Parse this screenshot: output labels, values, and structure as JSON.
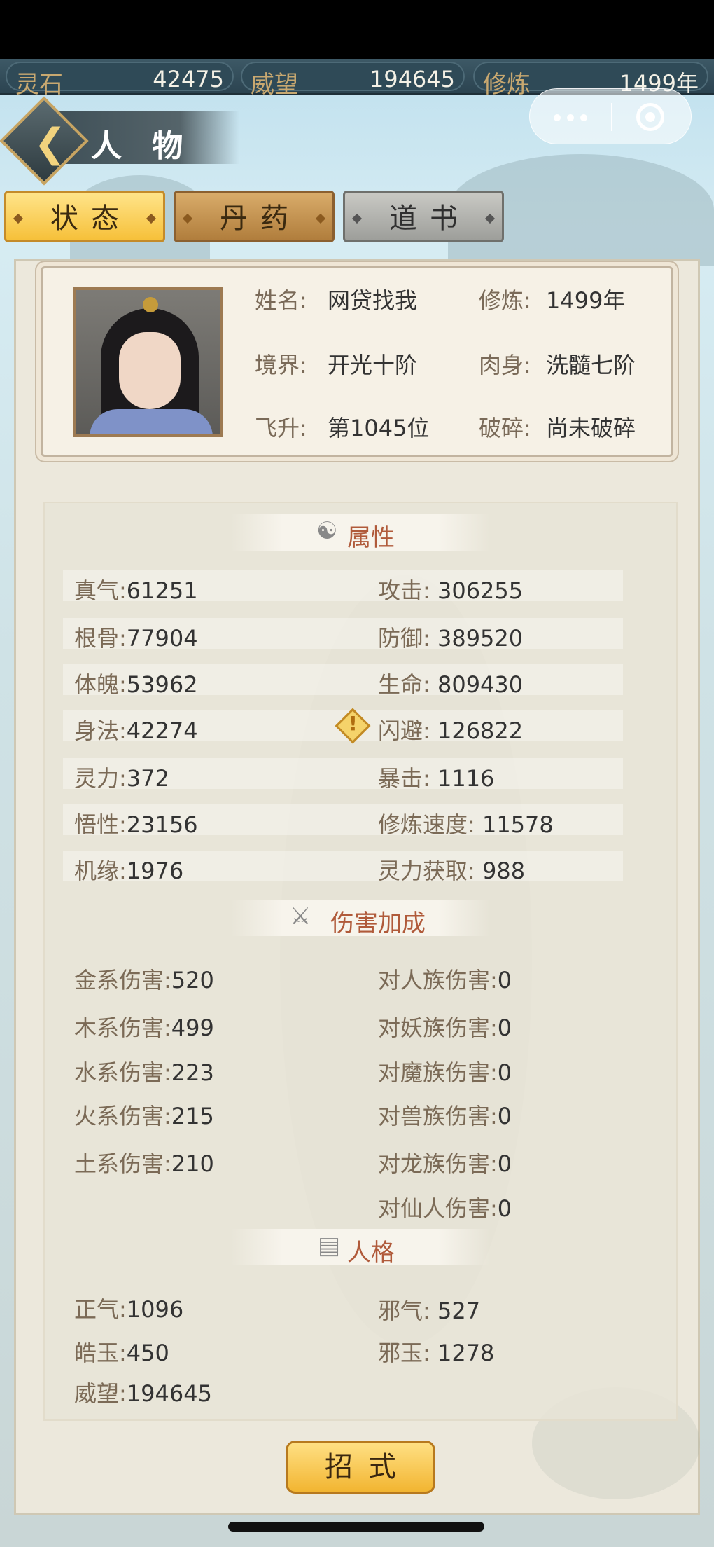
{
  "resources": [
    {
      "label": "灵石",
      "value": "42475"
    },
    {
      "label": "威望",
      "value": "194645"
    },
    {
      "label": "修炼",
      "value": "1499年"
    }
  ],
  "header": {
    "title": "人 物"
  },
  "tabs": [
    {
      "label": "状态",
      "active": true
    },
    {
      "label": "丹药",
      "active": false
    },
    {
      "label": "道书",
      "active": false
    }
  ],
  "profile": {
    "name_label": "姓名:",
    "name_value": "网贷找我",
    "cultivation_label": "修炼:",
    "cultivation_value": "1499年",
    "realm_label": "境界:",
    "realm_value": "开光十阶",
    "body_label": "肉身:",
    "body_value": "洗髓七阶",
    "ascend_label": "飞升:",
    "ascend_value": "第1045位",
    "shatter_label": "破碎:",
    "shatter_value": "尚未破碎"
  },
  "attributes": {
    "title": "属性",
    "left": [
      {
        "k": "真气:",
        "v": "61251"
      },
      {
        "k": "根骨:",
        "v": "77904"
      },
      {
        "k": "体魄:",
        "v": "53962"
      },
      {
        "k": "身法:",
        "v": "42274"
      },
      {
        "k": "灵力:",
        "v": "372"
      },
      {
        "k": "悟性:",
        "v": "23156"
      },
      {
        "k": "机缘:",
        "v": "1976"
      }
    ],
    "right": [
      {
        "k": "攻击:",
        "v": "306255"
      },
      {
        "k": "防御:",
        "v": "389520"
      },
      {
        "k": "生命:",
        "v": "809430"
      },
      {
        "k": "闪避:",
        "v": "126822"
      },
      {
        "k": "暴击:",
        "v": "1116"
      },
      {
        "k": "修炼速度:",
        "v": "11578"
      },
      {
        "k": "灵力获取:",
        "v": "988"
      }
    ]
  },
  "damage": {
    "title": "伤害加成",
    "left": [
      {
        "k": "金系伤害:",
        "v": "520"
      },
      {
        "k": "木系伤害:",
        "v": "499"
      },
      {
        "k": "水系伤害:",
        "v": "223"
      },
      {
        "k": "火系伤害:",
        "v": "215"
      },
      {
        "k": "土系伤害:",
        "v": "210"
      }
    ],
    "right": [
      {
        "k": "对人族伤害:",
        "v": "0"
      },
      {
        "k": "对妖族伤害:",
        "v": "0"
      },
      {
        "k": "对魔族伤害:",
        "v": "0"
      },
      {
        "k": "对兽族伤害:",
        "v": "0"
      },
      {
        "k": "对龙族伤害:",
        "v": "0"
      },
      {
        "k": "对仙人伤害:",
        "v": "0"
      }
    ]
  },
  "personality": {
    "title": "人格",
    "left": [
      {
        "k": "正气:",
        "v": "1096"
      },
      {
        "k": "皓玉:",
        "v": "450"
      },
      {
        "k": "威望:",
        "v": "194645"
      }
    ],
    "right": [
      {
        "k": "邪气:",
        "v": "527"
      },
      {
        "k": "邪玉:",
        "v": "1278"
      }
    ]
  },
  "skill_button": "招式"
}
